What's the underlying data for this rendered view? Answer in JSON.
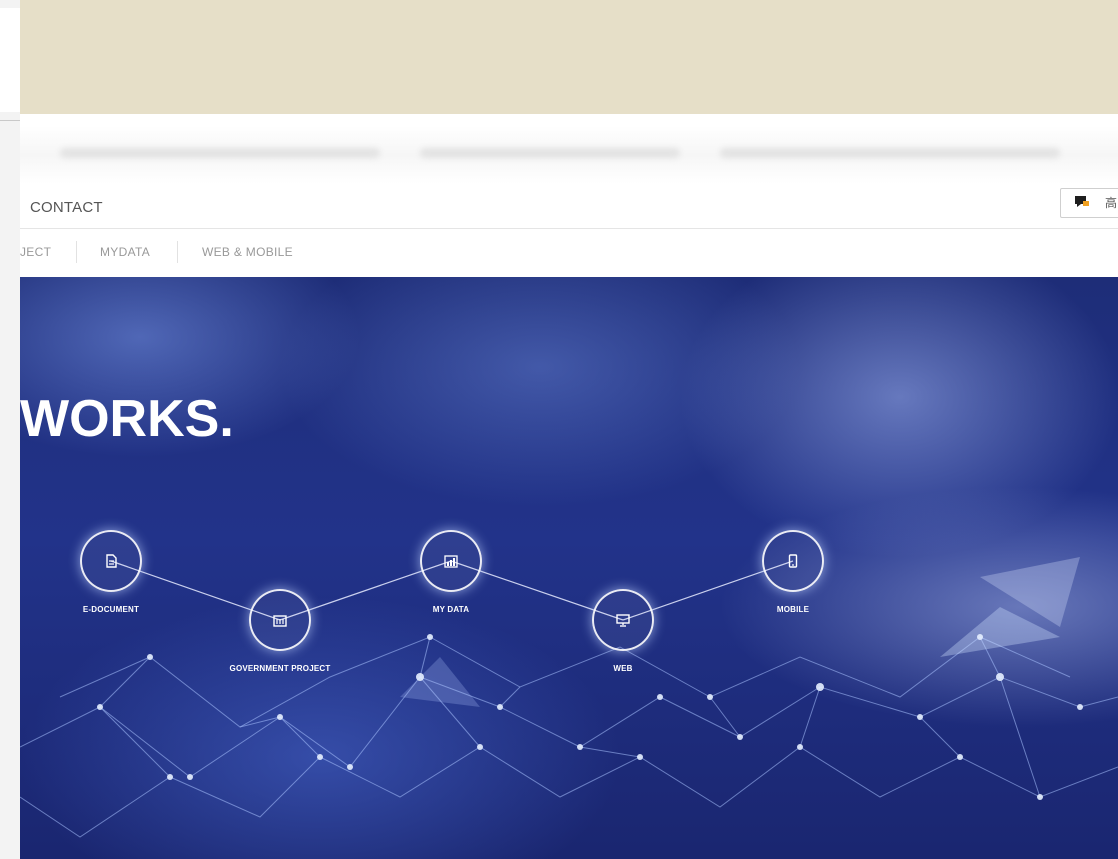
{
  "main_nav": {
    "contact_label": "CONTACT",
    "chat_button_label": "高"
  },
  "sub_nav": {
    "items": [
      "JECT",
      "MYDATA",
      "WEB & MOBILE"
    ]
  },
  "hero": {
    "title": "WORKS.",
    "nodes": [
      {
        "label": "E-DOCUMENT",
        "icon": "document-icon"
      },
      {
        "label": "GOVERNMENT PROJECT",
        "icon": "building-icon"
      },
      {
        "label": "MY DATA",
        "icon": "chart-icon"
      },
      {
        "label": "WEB",
        "icon": "monitor-icon"
      },
      {
        "label": "MOBILE",
        "icon": "phone-icon"
      }
    ]
  },
  "colors": {
    "banner": "#e6dfc8",
    "hero_bg": "#22338a",
    "chat_icon_dark": "#1e1e1e",
    "chat_icon_accent": "#f0a020"
  }
}
